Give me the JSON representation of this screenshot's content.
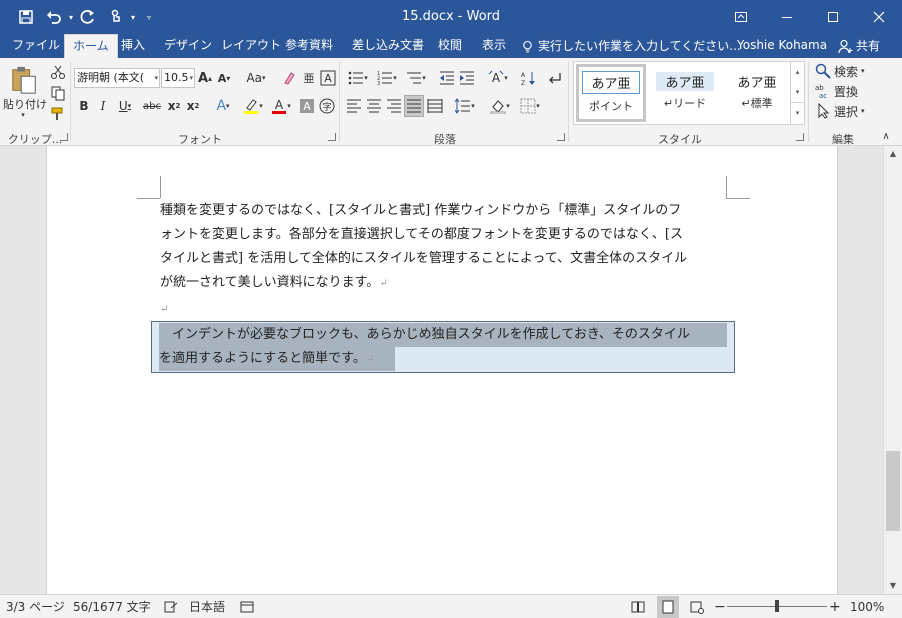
{
  "window": {
    "title": "15.docx - Word"
  },
  "tabs": [
    {
      "label": "ファイル"
    },
    {
      "label": "ホーム"
    },
    {
      "label": "挿入"
    },
    {
      "label": "デザイン"
    },
    {
      "label": "レイアウト"
    },
    {
      "label": "参考資料"
    },
    {
      "label": "差し込み文書"
    },
    {
      "label": "校閲"
    },
    {
      "label": "表示"
    }
  ],
  "tell_me": "実行したい作業を入力してください...",
  "user_name": "Yoshie Kohama",
  "share_label": "共有",
  "ribbon": {
    "clipboard": {
      "paste_label": "貼り付け",
      "group_label": "クリップ..."
    },
    "font": {
      "font_name": "游明朝 (本文(",
      "font_size": "10.5",
      "aa_label": "Aa",
      "group_label": "フォント"
    },
    "paragraph": {
      "group_label": "段落"
    },
    "styles": {
      "items": [
        {
          "preview": "あア亜",
          "name": "ポイント"
        },
        {
          "preview": "あア亜",
          "name": "↵リード"
        },
        {
          "preview": "あア亜",
          "name": "↵標準"
        }
      ],
      "group_label": "スタイル"
    },
    "editing": {
      "find": "検索",
      "replace": "置換",
      "select": "選択",
      "group_label": "編集"
    }
  },
  "document": {
    "para1": [
      "種類を変更するのではなく、[スタイルと書式] 作業ウィンドウから「標準」スタイルのフ",
      "ォントを変更します。各部分を直接選択してその都度フォントを変更するのではなく、[ス",
      "タイルと書式] を活用して全体的にスタイルを管理することによって、文書全体のスタイル",
      "が統一されて美しい資料になります。"
    ],
    "para_mark": "↵",
    "para3": [
      "　インデントが必要なブロックも、あらかじめ独自スタイルを作成しておき、そのスタイル",
      "を適用するようにすると簡単です。"
    ]
  },
  "status": {
    "page": "3/3 ページ",
    "words": "56/1677 文字",
    "language": "日本語",
    "zoom": "100%",
    "zoom_level": 1.0
  }
}
